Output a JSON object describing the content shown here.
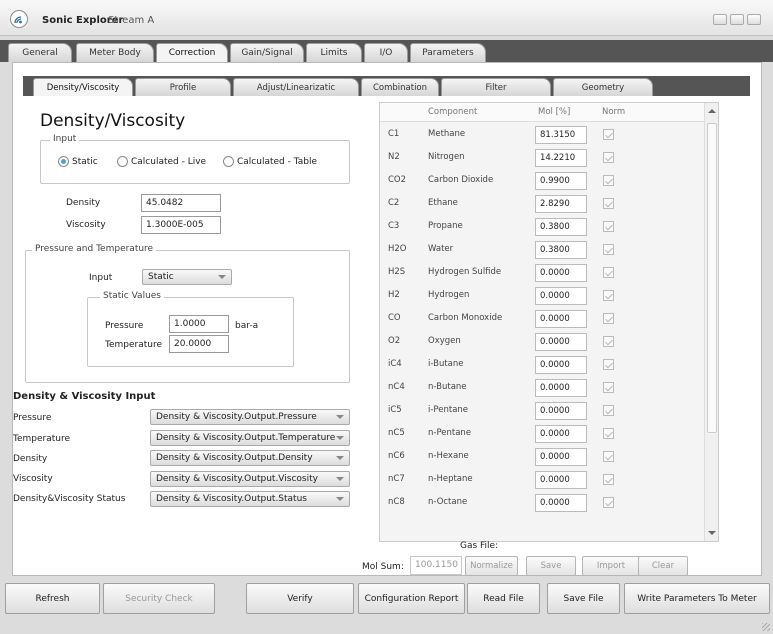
{
  "window": {
    "app_name": "Sonic Explorer",
    "stream": "Stream A"
  },
  "main_tabs": [
    "General",
    "Meter Body",
    "Correction",
    "Gain/Signal",
    "Limits",
    "I/O",
    "Parameters"
  ],
  "sub_tabs": [
    "Density/Viscosity",
    "Profile",
    "Adjust/Linearizatic",
    "Combination",
    "Filter",
    "Geometry"
  ],
  "dv": {
    "heading": "Density/Viscosity",
    "input_group_label": "Input",
    "radio": {
      "static": "Static",
      "live": "Calculated - Live",
      "table": "Calculated - Table",
      "selected": "Static"
    },
    "density_label": "Density",
    "density_value": "45.0482",
    "viscosity_label": "Viscosity",
    "viscosity_value": "1.3000E-005"
  },
  "pt": {
    "group_label": "Pressure and Temperature",
    "input_label": "Input",
    "input_value": "Static",
    "static_values_label": "Static Values",
    "pressure_label": "Pressure",
    "pressure_value": "1.0000",
    "pressure_unit": "bar-a",
    "temperature_label": "Temperature",
    "temperature_value": "20.0000"
  },
  "dvi": {
    "heading": "Density & Viscosity Input",
    "rows": [
      {
        "label": "Pressure",
        "value": "Density & Viscosity.Output.Pressure"
      },
      {
        "label": "Temperature",
        "value": "Density & Viscosity.Output.Temperature"
      },
      {
        "label": "Density",
        "value": "Density & Viscosity.Output.Density"
      },
      {
        "label": "Viscosity",
        "value": "Density & Viscosity.Output.Viscosity"
      },
      {
        "label": "Density&Viscosity Status",
        "value": "Density & Viscosity.Output.Status"
      }
    ]
  },
  "gas_table": {
    "headers": {
      "component": "Component",
      "mol": "Mol [%]",
      "norm": "Norm"
    },
    "rows": [
      {
        "code": "C1",
        "name": "Methane",
        "mol": "81.3150",
        "norm": true
      },
      {
        "code": "N2",
        "name": "Nitrogen",
        "mol": "14.2210",
        "norm": true
      },
      {
        "code": "CO2",
        "name": "Carbon Dioxide",
        "mol": "0.9900",
        "norm": true
      },
      {
        "code": "C2",
        "name": "Ethane",
        "mol": "2.8290",
        "norm": true
      },
      {
        "code": "C3",
        "name": "Propane",
        "mol": "0.3800",
        "norm": true
      },
      {
        "code": "H2O",
        "name": "Water",
        "mol": "0.3800",
        "norm": true
      },
      {
        "code": "H2S",
        "name": "Hydrogen Sulfide",
        "mol": "0.0000",
        "norm": true
      },
      {
        "code": "H2",
        "name": "Hydrogen",
        "mol": "0.0000",
        "norm": true
      },
      {
        "code": "CO",
        "name": "Carbon Monoxide",
        "mol": "0.0000",
        "norm": true
      },
      {
        "code": "O2",
        "name": "Oxygen",
        "mol": "0.0000",
        "norm": true
      },
      {
        "code": "iC4",
        "name": "i-Butane",
        "mol": "0.0000",
        "norm": true
      },
      {
        "code": "nC4",
        "name": "n-Butane",
        "mol": "0.0000",
        "norm": true
      },
      {
        "code": "iC5",
        "name": "i-Pentane",
        "mol": "0.0000",
        "norm": true
      },
      {
        "code": "nC5",
        "name": "n-Pentane",
        "mol": "0.0000",
        "norm": true
      },
      {
        "code": "nC6",
        "name": "n-Hexane",
        "mol": "0.0000",
        "norm": true
      },
      {
        "code": "nC7",
        "name": "n-Heptane",
        "mol": "0.0000",
        "norm": true
      },
      {
        "code": "nC8",
        "name": "n-Octane",
        "mol": "0.0000",
        "norm": true
      }
    ]
  },
  "gas_footer": {
    "gas_file_label": "Gas File:",
    "mol_sum_label": "Mol Sum:",
    "mol_sum_value": "100.1150",
    "normalize": "Normalize",
    "save": "Save",
    "import": "Import",
    "clear": "Clear"
  },
  "bottom_buttons": {
    "refresh": "Refresh",
    "security": "Security Check",
    "verify": "Verify",
    "config_report": "Configuration Report",
    "read_file": "Read File",
    "save_file": "Save File",
    "write_params": "Write Parameters To Meter"
  },
  "colors": {
    "tab_strip": "#555555",
    "radio_selected": "#4aa3d8"
  }
}
